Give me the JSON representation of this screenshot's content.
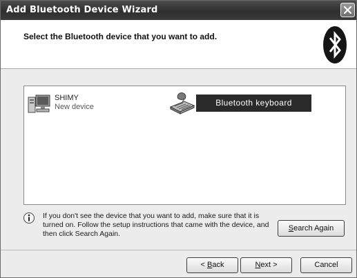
{
  "window": {
    "title": "Add Bluetooth Device Wizard",
    "close_icon": "close-x-icon"
  },
  "header": {
    "instruction": "Select the Bluetooth device that you want to add.",
    "logo_icon": "bluetooth-logo-icon"
  },
  "device_list": {
    "items": [
      {
        "name": "SHIMY",
        "status": "New device",
        "icon": "computer-icon",
        "selected": false
      },
      {
        "name": "Bluetooth keyboard",
        "status": "",
        "icon": "keyboard-icon",
        "selected": true
      }
    ]
  },
  "info": {
    "icon": "info-icon",
    "text": "If you don't see the device that you want to add, make sure that it is turned on. Follow the setup instructions that came with the device, and then click Search Again."
  },
  "buttons": {
    "search_again": {
      "mnemonic": "S",
      "rest": "earch Again"
    },
    "back": {
      "prefix": "< ",
      "mnemonic": "B",
      "rest": "ack"
    },
    "next": {
      "mnemonic": "N",
      "rest": "ext >"
    },
    "cancel": "Cancel"
  },
  "colors": {
    "titlebar": "#3a3a3a",
    "selection": "#2a2a2a",
    "panel": "#ececec"
  }
}
